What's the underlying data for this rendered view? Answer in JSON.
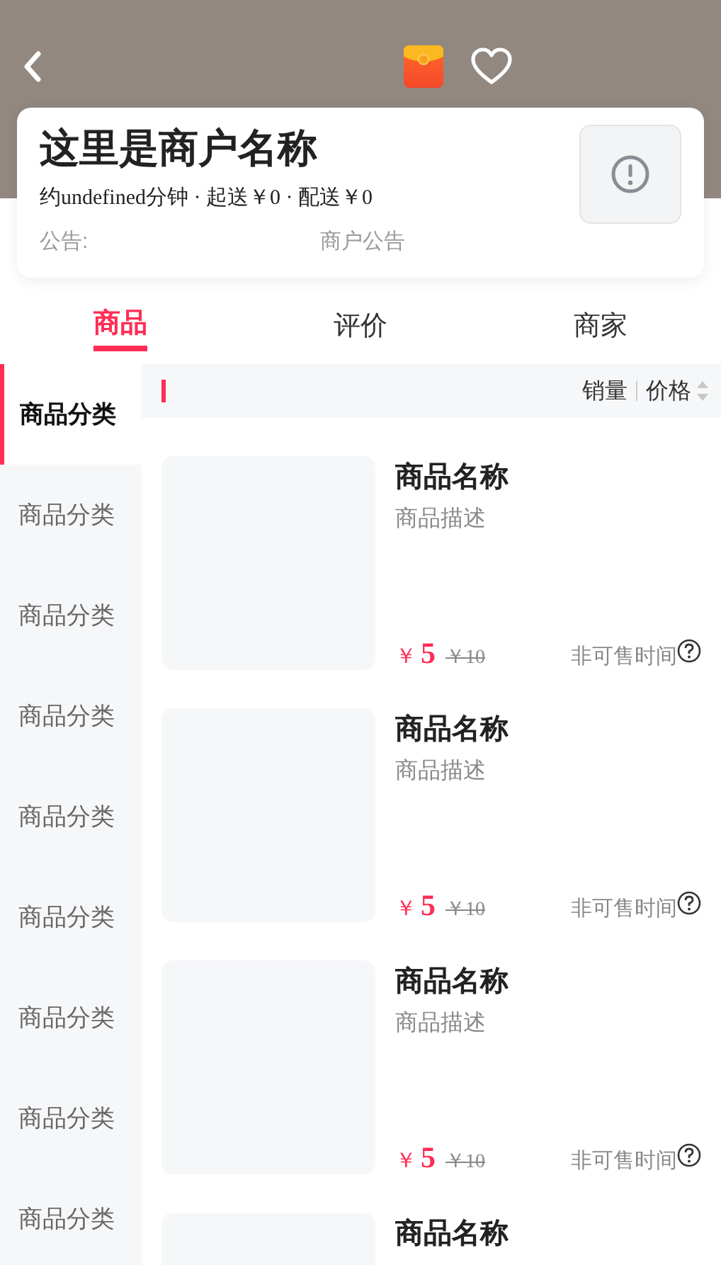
{
  "shop": {
    "name": "这里是商户名称",
    "delivery_info": "约undefined分钟 · 起送￥0 · 配送￥0",
    "notice_label": "公告:",
    "notice": "商户公告"
  },
  "tabs": [
    {
      "label": "商品",
      "selected": true
    },
    {
      "label": "评价",
      "selected": false
    },
    {
      "label": "商家",
      "selected": false
    }
  ],
  "categories": [
    {
      "label": "商品分类",
      "selected": true
    },
    {
      "label": "商品分类",
      "selected": false
    },
    {
      "label": "商品分类",
      "selected": false
    },
    {
      "label": "商品分类",
      "selected": false
    },
    {
      "label": "商品分类",
      "selected": false
    },
    {
      "label": "商品分类",
      "selected": false
    },
    {
      "label": "商品分类",
      "selected": false
    },
    {
      "label": "商品分类",
      "selected": false
    },
    {
      "label": "商品分类",
      "selected": false
    }
  ],
  "sort_options": [
    {
      "label": "销量",
      "kind": "plain"
    },
    {
      "label": "价格",
      "kind": "sortable"
    }
  ],
  "products": [
    {
      "name": "商品名称",
      "description": "商品描述",
      "currency": "￥",
      "price": "5",
      "original_price": "￥10",
      "status": "非可售时间"
    },
    {
      "name": "商品名称",
      "description": "商品描述",
      "currency": "￥",
      "price": "5",
      "original_price": "￥10",
      "status": "非可售时间"
    },
    {
      "name": "商品名称",
      "description": "商品描述",
      "currency": "￥",
      "price": "5",
      "original_price": "￥10",
      "status": "非可售时间"
    },
    {
      "name": "商品名称"
    }
  ]
}
